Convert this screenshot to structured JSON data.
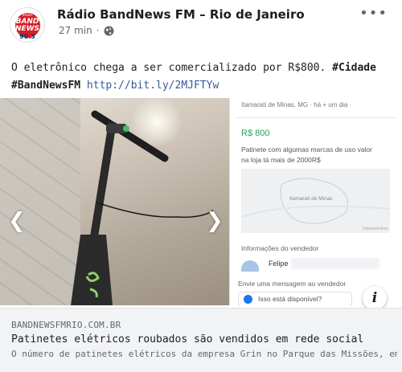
{
  "post": {
    "page_name": "Rádio BandNews FM – Rio de Janeiro",
    "time": "27 min",
    "separator": "·",
    "privacy_icon": "globe-icon",
    "more_icon": "more-options-icon",
    "text_before": "O eletrônico chega a ser comercializado por R$800. ",
    "hashtag_1": "#Cidade",
    "hashtag_2": "#BandNewsFM",
    "short_link": "http://bit.ly/2MJFTYw"
  },
  "avatar": {
    "radio_word": "RÁDIO",
    "brand": "BAND NEWS",
    "frequency": "90.3"
  },
  "media": {
    "prev_icon": "chevron-left-icon",
    "next_icon": "chevron-right-icon",
    "listing": {
      "location": "Itamarati de Minas, MG · há + um dia · ",
      "price": "R$ 800",
      "description": "Patinete com algumas marcas de uso valor na loja tá mais de 2000R$",
      "map_label": "Itamarati de Minas",
      "map_credit": "Datasemelhos",
      "vendor_heading": "Informações do vendedor",
      "vendor_name": "Felipe",
      "message_heading": "Envie uma mensagem ao vendedor",
      "message_placeholder": "Isso está disponível?"
    },
    "info_label": "i"
  },
  "link_preview": {
    "domain": "BANDNEWSFMRIO.COM.BR",
    "title": "Patinetes elétricos roubados são vendidos em rede social",
    "description": "O número de patinetes elétricos da empresa Grin no Parque das Missões, em Duque de..."
  },
  "colors": {
    "link": "#385898",
    "price_green": "#2e9e5a",
    "brand_red": "#d81f26",
    "preview_bg": "#f2f3f5"
  }
}
